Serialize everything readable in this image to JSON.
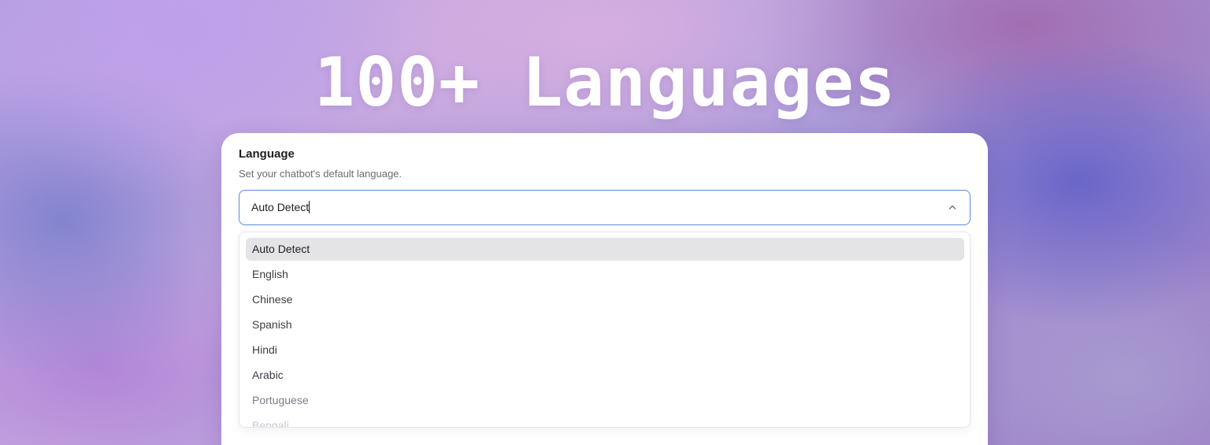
{
  "hero": {
    "title": "100+ Languages"
  },
  "language_setting": {
    "label": "Language",
    "description": "Set your chatbot's default language.",
    "select": {
      "value": "Auto Detect",
      "expanded": true,
      "icon": "chevron-up-icon"
    },
    "options": [
      {
        "label": "Auto Detect",
        "selected": true
      },
      {
        "label": "English"
      },
      {
        "label": "Chinese"
      },
      {
        "label": "Spanish"
      },
      {
        "label": "Hindi"
      },
      {
        "label": "Arabic"
      },
      {
        "label": "Portuguese"
      },
      {
        "label": "Bengali"
      }
    ]
  },
  "colors": {
    "focus_border": "#5b88e0",
    "selected_option_bg": "#e4e4e7",
    "card_bg": "#ffffff",
    "hero_text": "#ffffff"
  }
}
